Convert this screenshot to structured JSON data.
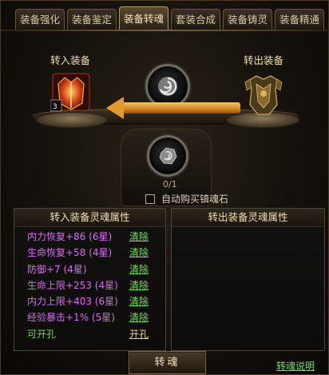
{
  "tabs": [
    {
      "label": "装备强化",
      "active": false
    },
    {
      "label": "装备鉴定",
      "active": false
    },
    {
      "label": "装备转魂",
      "active": true
    },
    {
      "label": "套装合成",
      "active": false
    },
    {
      "label": "装备铸灵",
      "active": false
    },
    {
      "label": "装备精通",
      "active": false
    }
  ],
  "labels": {
    "transfer_in": "转入装备",
    "transfer_out": "转出装备"
  },
  "slots": {
    "soul_counter": "0/1",
    "stone_counter": "0/1"
  },
  "auto_buy": {
    "label": "自动购买镇魂石",
    "checked": false
  },
  "left_panel": {
    "title": "转入装备灵魂属性",
    "rows": [
      {
        "text": "内力恢复+86 (6星)",
        "action": "清除",
        "text_color": "#d86cf0",
        "action_color": "#74e05a"
      },
      {
        "text": "生命恢复+58 (4星)",
        "action": "清除",
        "text_color": "#d86cf0",
        "action_color": "#74e05a"
      },
      {
        "text": "防御+7 (4星)",
        "action": "清除",
        "text_color": "#d86cf0",
        "action_color": "#74e05a"
      },
      {
        "text": "生命上限+253 (4星)",
        "action": "清除",
        "text_color": "#d86cf0",
        "action_color": "#74e05a"
      },
      {
        "text": "内力上限+403 (6星)",
        "action": "清除",
        "text_color": "#d86cf0",
        "action_color": "#74e05a"
      },
      {
        "text": "经验暴击+1% (5星)",
        "action": "清除",
        "text_color": "#d86cf0",
        "action_color": "#74e05a"
      },
      {
        "text": "可开孔",
        "action": "开孔",
        "text_color": "#6fd84a",
        "action_color": "#f0d25a"
      }
    ]
  },
  "right_panel": {
    "title": "转出装备灵魂属性"
  },
  "buttons": {
    "transfer": "转魂",
    "help": "转魂说明"
  },
  "colors": {
    "accent_orange": "#e39a2b",
    "gold_text": "#f2dfb0"
  }
}
